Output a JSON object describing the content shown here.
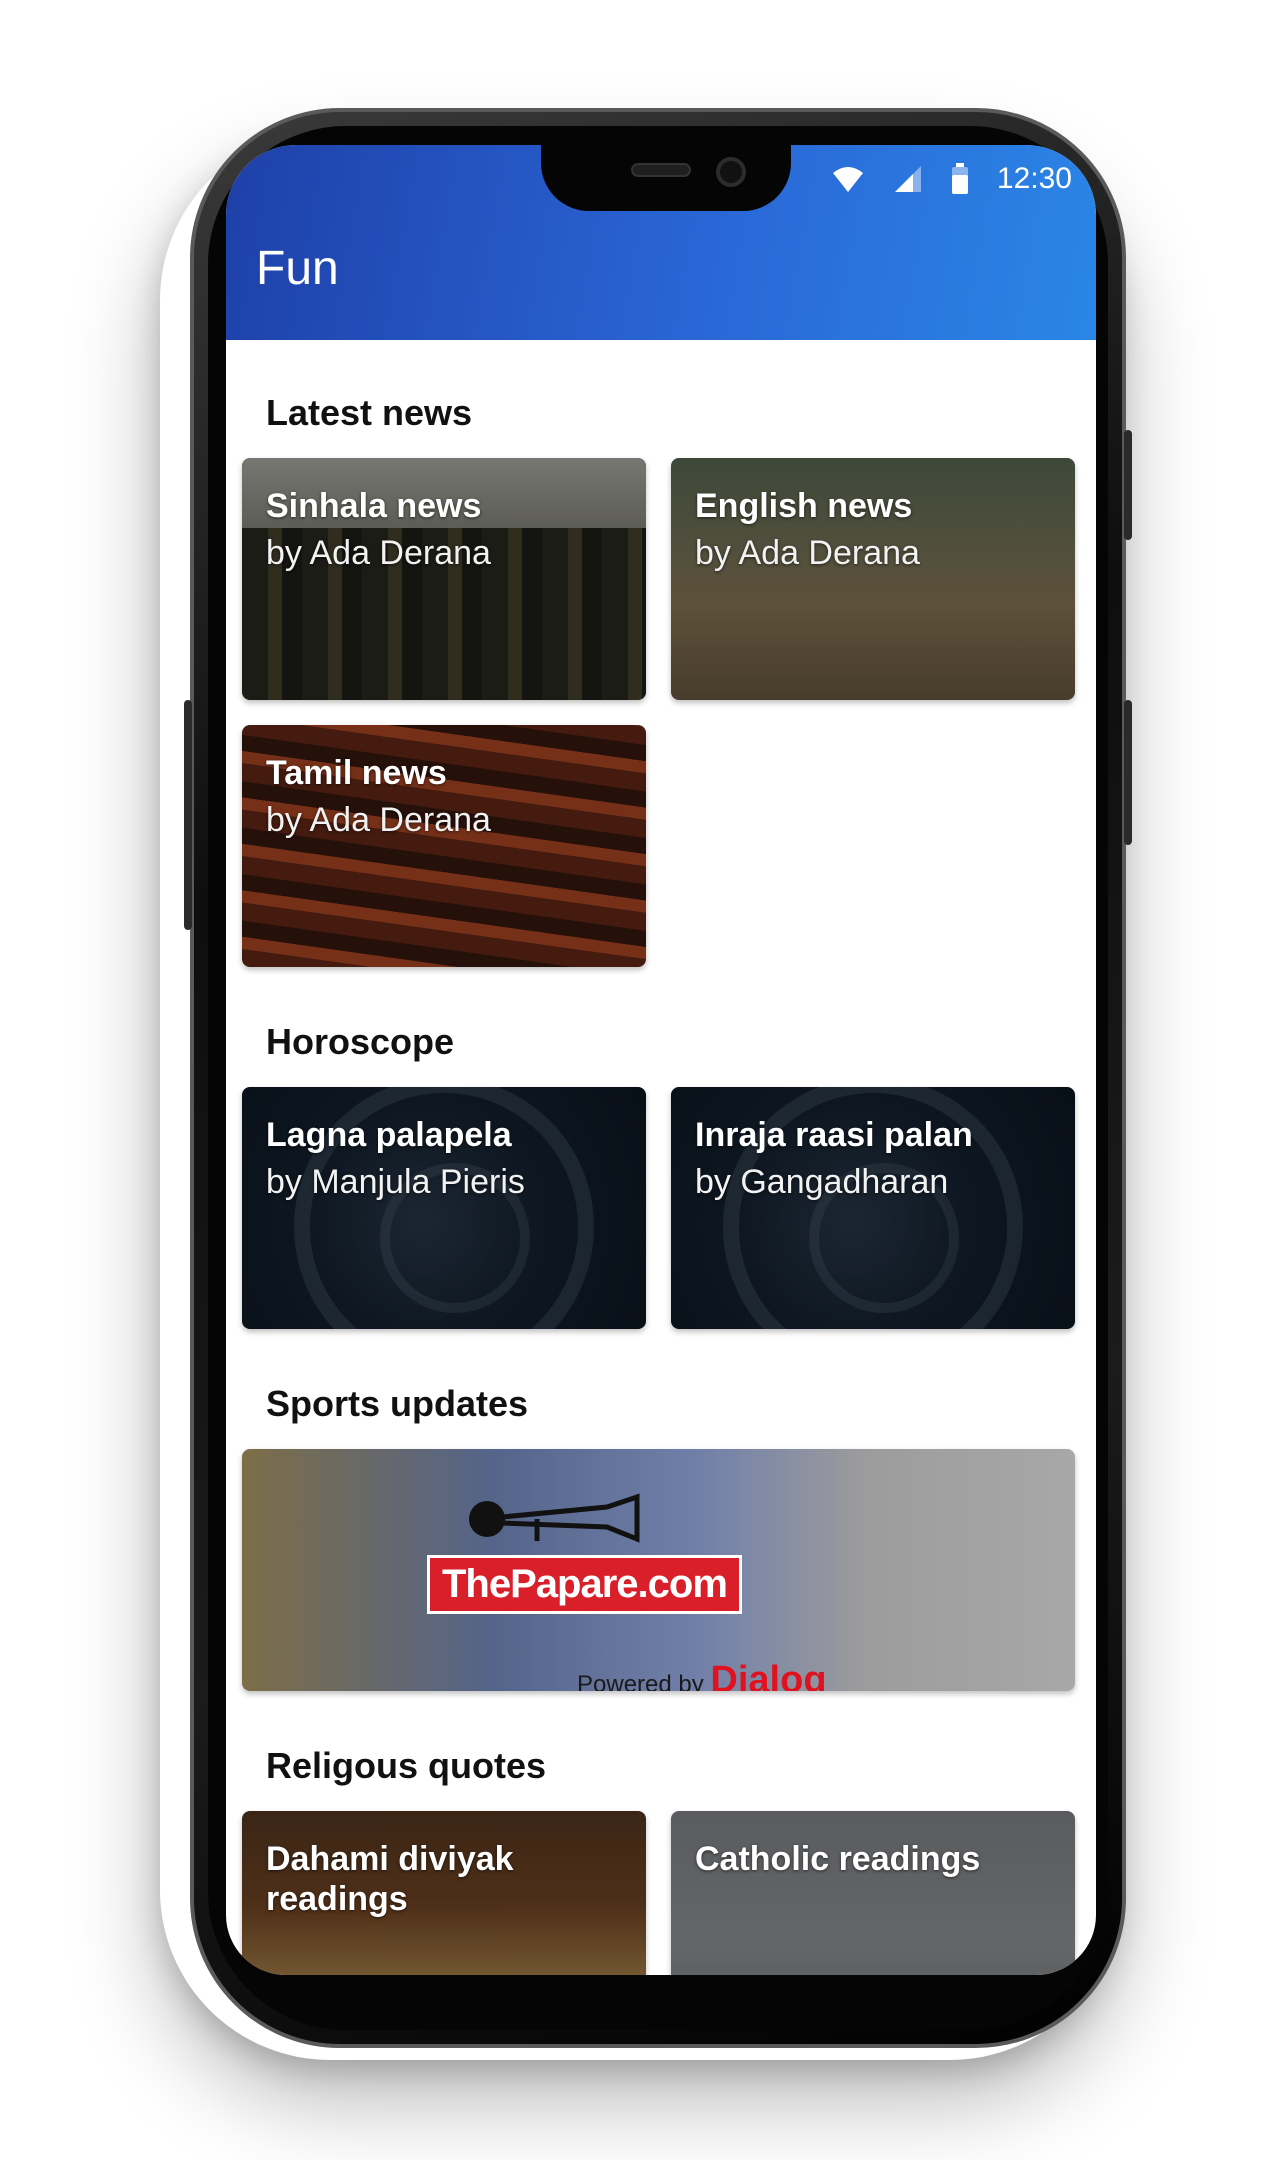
{
  "status_bar": {
    "time": "12:30"
  },
  "appbar": {
    "title": "Fun"
  },
  "sections": {
    "latest_news": {
      "title": "Latest news",
      "cards": [
        {
          "title": "Sinhala news",
          "subtitle": "by Ada Derana"
        },
        {
          "title": "English news",
          "subtitle": "by Ada Derana"
        },
        {
          "title": "Tamil news",
          "subtitle": "by Ada Derana"
        }
      ]
    },
    "horoscope": {
      "title": "Horoscope",
      "cards": [
        {
          "title": "Lagna palapela",
          "subtitle": "by Manjula Pieris"
        },
        {
          "title": "Inraja raasi palan",
          "subtitle": "by Gangadharan"
        }
      ]
    },
    "sports": {
      "title": "Sports updates",
      "banner": {
        "brand": "ThePapare.com",
        "powered_by": "Powered by",
        "partner": "Dialog"
      }
    },
    "religious": {
      "title": "Religous quotes",
      "cards": [
        {
          "title": "Dahami diviyak readings"
        },
        {
          "title": "Catholic readings"
        }
      ]
    }
  },
  "colors": {
    "appbar_start": "#1e40a8",
    "appbar_end": "#2a86e6",
    "brand_red": "#d81f2a"
  }
}
